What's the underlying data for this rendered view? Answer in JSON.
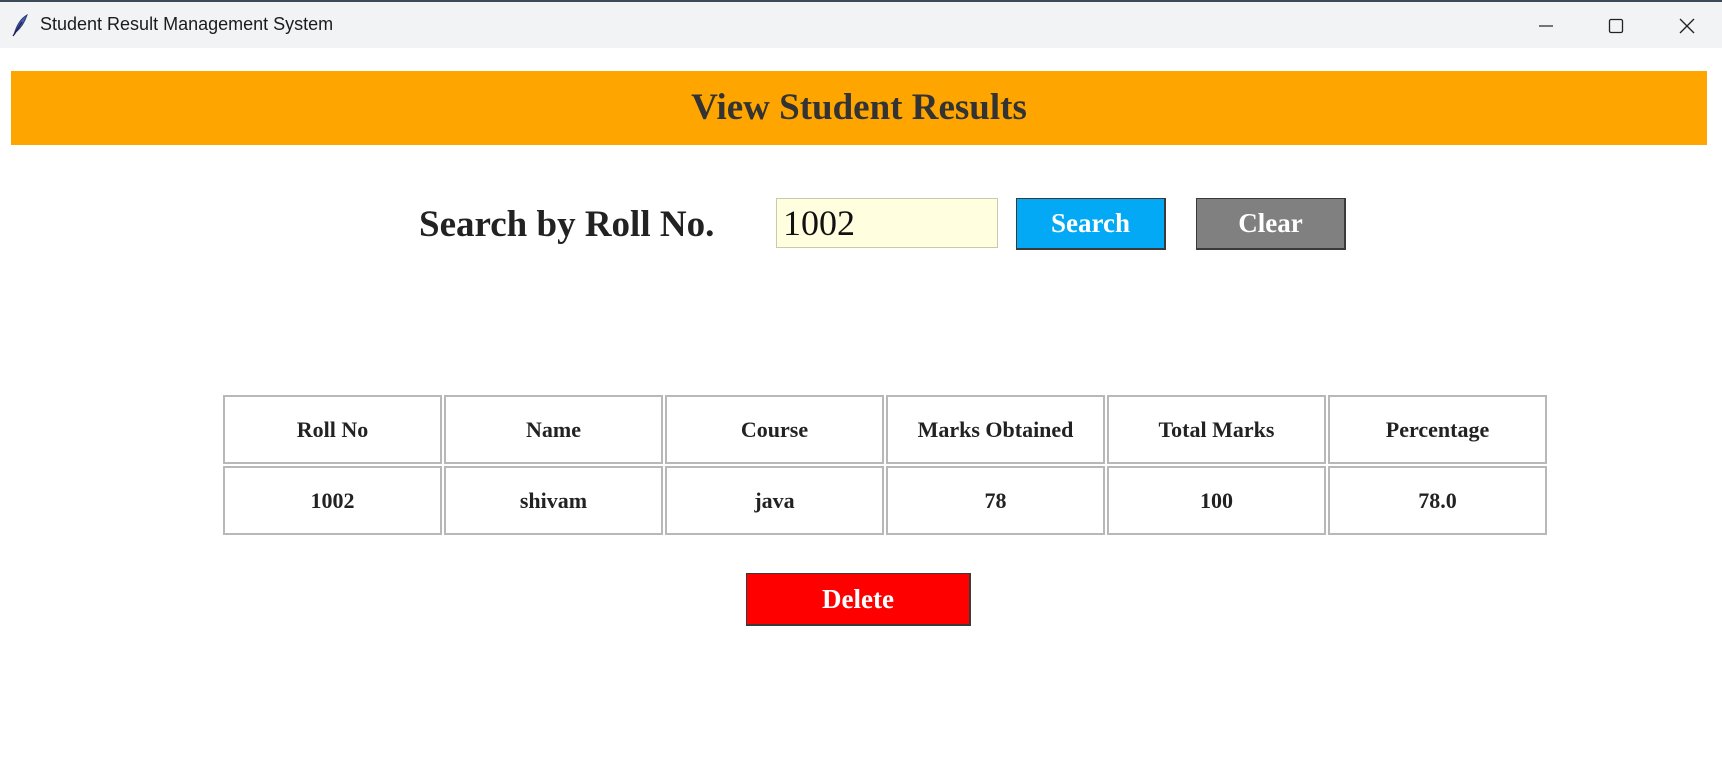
{
  "window": {
    "title": "Student Result Management System",
    "icon": "feather-icon"
  },
  "banner": {
    "heading": "View Student Results",
    "color": "#ffa500"
  },
  "search": {
    "label": "Search by Roll No.",
    "value": "1002",
    "search_button": "Search",
    "clear_button": "Clear"
  },
  "table": {
    "headers": [
      "Roll No",
      "Name",
      "Course",
      "Marks Obtained",
      "Total Marks",
      "Percentage"
    ],
    "rows": [
      [
        "1002",
        "shivam",
        "java",
        "78",
        "100",
        "78.0"
      ]
    ]
  },
  "actions": {
    "delete_button": "Delete"
  },
  "colors": {
    "search": "#03a9f4",
    "clear": "#808080",
    "delete": "#ff0000"
  }
}
